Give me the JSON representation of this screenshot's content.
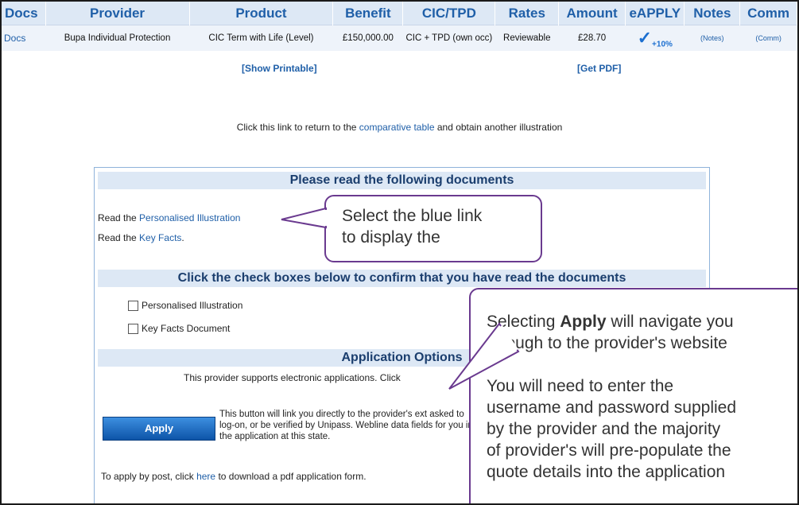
{
  "table": {
    "headers": [
      "Docs",
      "Provider",
      "Product",
      "Benefit",
      "CIC/TPD",
      "Rates",
      "Amount",
      "eAPPLY",
      "Notes",
      "Comm"
    ],
    "row": {
      "docs": "Docs",
      "provider": "Bupa Individual Protection",
      "product": "CIC Term with Life (Level)",
      "benefit": "£150,000.00",
      "cic": "CIC + TPD (own occ)",
      "rates": "Reviewable",
      "amount": "£28.70",
      "eapply_mark": "✓",
      "eapply_pct": "+10%",
      "notes": "(Notes)",
      "comm": "(Comm)"
    }
  },
  "links": {
    "printable": "[Show Printable]",
    "pdf": "[Get PDF]"
  },
  "return_text": {
    "before": "Click this link to return to the",
    "link": "comparative table",
    "after": "and obtain another illustration"
  },
  "documents": {
    "title": "Please read the following documents",
    "read1_prefix": "Read the",
    "read1_link": "Personalised Illustration",
    "read2_prefix": "Read the",
    "read2_link": "Key Facts",
    "read2_suffix": ".",
    "confirm_title": "Click the check boxes below to confirm that you have read the documents",
    "check1": "Personalised Illustration",
    "check2": "Key Facts Document",
    "options_title": "Application Options",
    "options_text": "This provider supports electronic applications. Click",
    "apply_label": "Apply",
    "apply_desc": "This button will link you directly to the provider's ext asked to log-on, or be verified by Unipass. Webline data fields for you into the application at this state.",
    "post_prefix": "To apply by post, click",
    "post_link": "here",
    "post_suffix": "to download a pdf application form."
  },
  "callouts": {
    "c1_line1": "Select the blue link",
    "c1_line2": "to display the",
    "c2_pre": "Selecting",
    "c2_bold": "Apply",
    "c2_line1_rest": "will navigate you",
    "c2_line2": "through to the provider's website",
    "c2_line3": "You will need to enter the",
    "c2_line4": "username and password supplied",
    "c2_line5": "by the provider and the majority",
    "c2_line6": "of provider's will pre-populate the",
    "c2_line7": "quote details into the application"
  }
}
